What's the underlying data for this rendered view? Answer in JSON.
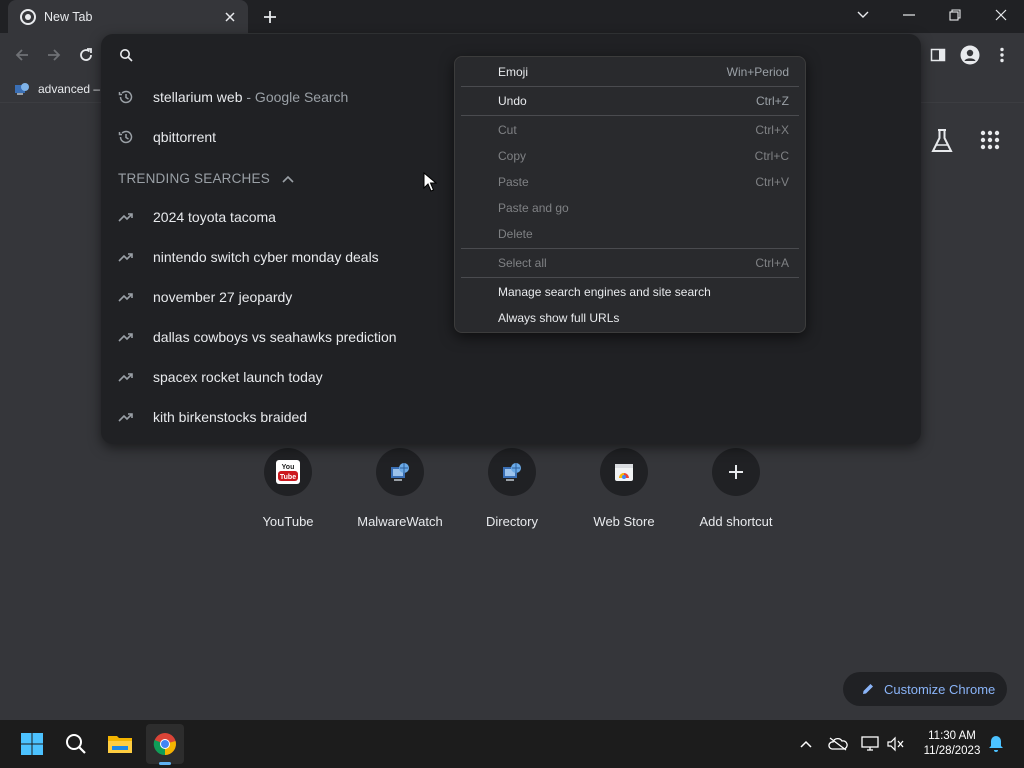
{
  "tab": {
    "title": "New Tab"
  },
  "bookmarks": {
    "item": "advanced –"
  },
  "omnibox": {
    "history": [
      {
        "text": "stellarium web",
        "suffix": " - Google Search"
      },
      {
        "text": "qbittorrent",
        "suffix": ""
      }
    ],
    "trending_header": "TRENDING SEARCHES",
    "trending": [
      "2024 toyota tacoma",
      "nintendo switch cyber monday deals",
      "november 27 jeopardy",
      "dallas cowboys vs seahawks prediction",
      "spacex rocket launch today",
      "kith birkenstocks braided"
    ]
  },
  "context_menu": {
    "items": [
      {
        "label": "Emoji",
        "accel": "Win+Period"
      },
      {
        "label": "Undo",
        "accel": "Ctrl+Z"
      },
      {
        "label": "Cut",
        "accel": "Ctrl+X"
      },
      {
        "label": "Copy",
        "accel": "Ctrl+C"
      },
      {
        "label": "Paste",
        "accel": "Ctrl+V"
      },
      {
        "label": "Paste and go",
        "accel": ""
      },
      {
        "label": "Delete",
        "accel": ""
      },
      {
        "label": "Select all",
        "accel": "Ctrl+A"
      },
      {
        "label": "Manage search engines and site search",
        "accel": ""
      },
      {
        "label": "Always show full URLs",
        "accel": ""
      }
    ]
  },
  "shortcuts": [
    {
      "label": "YouTube",
      "icon": "youtube-icon"
    },
    {
      "label": "MalwareWatch",
      "icon": "computer-globe-icon"
    },
    {
      "label": "Directory",
      "icon": "computer-globe-icon"
    },
    {
      "label": "Web Store",
      "icon": "web-store-icon"
    },
    {
      "label": "Add shortcut",
      "icon": "plus-icon"
    }
  ],
  "customize_label": "Customize Chrome",
  "clock": {
    "time": "11:30 AM",
    "date": "11/28/2023"
  },
  "colors": {
    "accent": "#8ab4f8",
    "background": "#35363a",
    "popup": "#202124",
    "taskbar_indicator": "#5fb2f2"
  }
}
